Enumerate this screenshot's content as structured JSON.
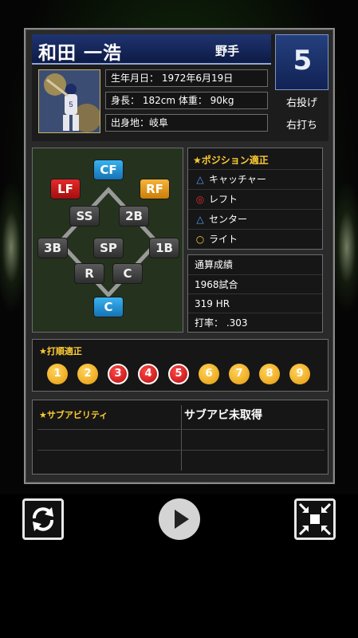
{
  "player": {
    "name": "和田 一浩",
    "role": "野手",
    "number": "5",
    "birth": "生年月日： 1972年6月19日",
    "body": "身長： 182cm 体重： 90kg",
    "hometown": "出身地：岐阜",
    "throws": "右投げ",
    "bats": "右打ち"
  },
  "positions": {
    "CF": "CF",
    "LF": "LF",
    "RF": "RF",
    "SS": "SS",
    "2B": "2B",
    "3B": "3B",
    "SP": "SP",
    "1B": "1B",
    "R": "R",
    "C1": "C",
    "C2": "C"
  },
  "position_aptitude": {
    "title": "★ポジション適正",
    "items": [
      {
        "mark": "△",
        "label": "キャッチャー"
      },
      {
        "mark": "◎",
        "label": "レフト"
      },
      {
        "mark": "△",
        "label": "センター"
      },
      {
        "mark": "○",
        "label": "ライト"
      }
    ]
  },
  "career": {
    "title": "通算成績",
    "games": "1968試合",
    "hr": "319 HR",
    "avg": "打率： .303"
  },
  "batting_order": {
    "title": "★打順適正",
    "orders": [
      "1",
      "2",
      "3",
      "4",
      "5",
      "6",
      "7",
      "8",
      "9"
    ]
  },
  "sub_ability": {
    "title": "★サブアビリティ",
    "value": "サブアビ未取得"
  },
  "colors": {
    "accent_blue": "#1f3470",
    "gold": "#ffcc33",
    "red": "#e42a2a"
  }
}
